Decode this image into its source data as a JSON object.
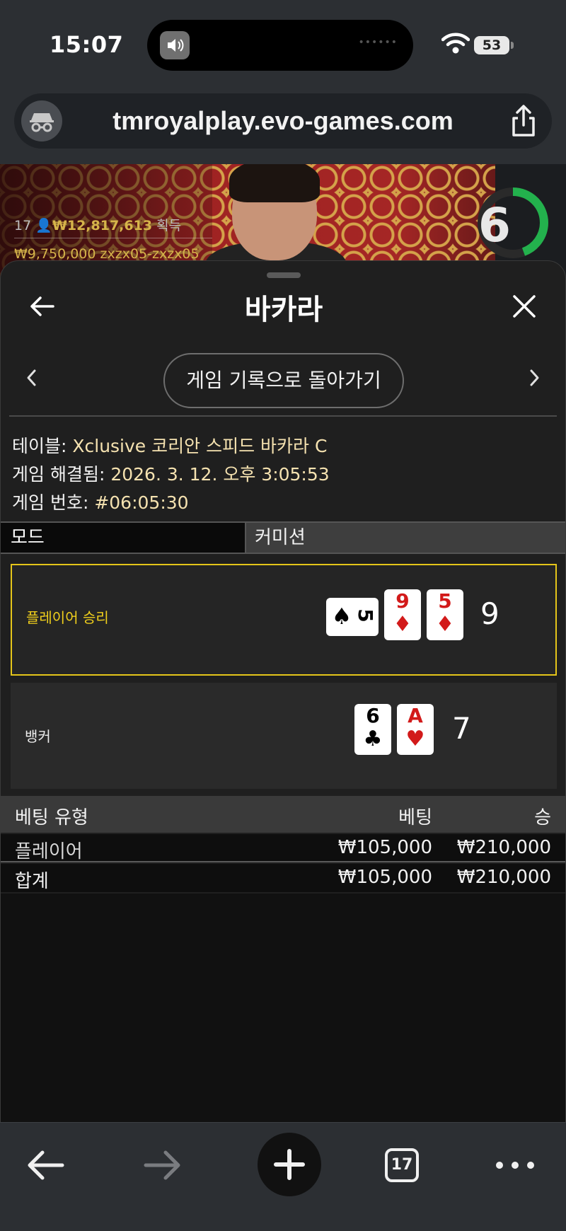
{
  "status_bar": {
    "time": "15:07",
    "battery": "53"
  },
  "browser": {
    "url": "tmroyalplay.evo-games.com",
    "tab_count": "17"
  },
  "video": {
    "player_count": "17",
    "payout_total": "₩12,817,613",
    "payout_suffix": "획득",
    "winner_amount": "₩9,750,000",
    "winner_name": "zxzx05-zxzx05",
    "timer": "6",
    "colors": {
      "gold": "#d6b44a",
      "timer_ring": "#23b14d"
    }
  },
  "sheet": {
    "title": "바카라",
    "history_button": "게임 기록으로 돌아가기",
    "info": {
      "table_label": "테이블: ",
      "table_value": "Xclusive 코리안 스피드 바카라 C",
      "resolved_label": "게임 해결됨: ",
      "resolved_value": "2026. 3. 12. 오후 3:05:53",
      "number_label": "게임 번호: ",
      "number_value": "#06:05:30"
    },
    "tabs": {
      "mode": "모드",
      "commission": "커미션"
    },
    "results": {
      "player": {
        "label": "플레이어 승리",
        "cards": [
          {
            "rank": "5",
            "suit": "♠",
            "color": "black",
            "orientation": "sideways"
          },
          {
            "rank": "9",
            "suit": "♦",
            "color": "red"
          },
          {
            "rank": "5",
            "suit": "♦",
            "color": "red"
          }
        ],
        "score": "9"
      },
      "banker": {
        "label": "뱅커",
        "cards": [
          {
            "rank": "6",
            "suit": "♣",
            "color": "black"
          },
          {
            "rank": "A",
            "suit": "♥",
            "color": "red"
          }
        ],
        "score": "7"
      },
      "colors": {
        "winner_border": "#e4c51a"
      }
    },
    "bets": {
      "headers": {
        "type": "베팅 유형",
        "bet": "베팅",
        "win": "승"
      },
      "rows": [
        {
          "type": "플레이어",
          "bet": "₩105,000",
          "win": "₩210,000"
        }
      ],
      "total": {
        "type": "합계",
        "bet": "₩105,000",
        "win": "₩210,000"
      }
    }
  }
}
